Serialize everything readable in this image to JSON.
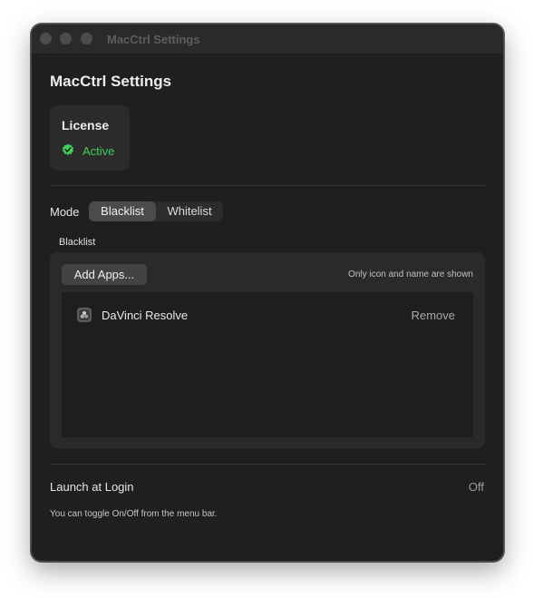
{
  "window": {
    "title": "MacCtrl Settings"
  },
  "page": {
    "title": "MacCtrl Settings"
  },
  "license": {
    "title": "License",
    "status": "Active",
    "status_icon": "checkmark-seal-icon",
    "status_color": "#3ecf5b"
  },
  "mode": {
    "label": "Mode",
    "options": [
      "Blacklist",
      "Whitelist"
    ],
    "selected": "Blacklist"
  },
  "blacklist": {
    "section_label": "Blacklist",
    "add_button_label": "Add Apps...",
    "hint": "Only icon and name are shown",
    "apps": [
      {
        "name": "DaVinci Resolve",
        "icon": "davinci-resolve-icon",
        "action_label": "Remove"
      }
    ]
  },
  "launch_at_login": {
    "label": "Launch at Login",
    "value": "Off",
    "hint": "You can toggle On/Off from the menu bar."
  }
}
